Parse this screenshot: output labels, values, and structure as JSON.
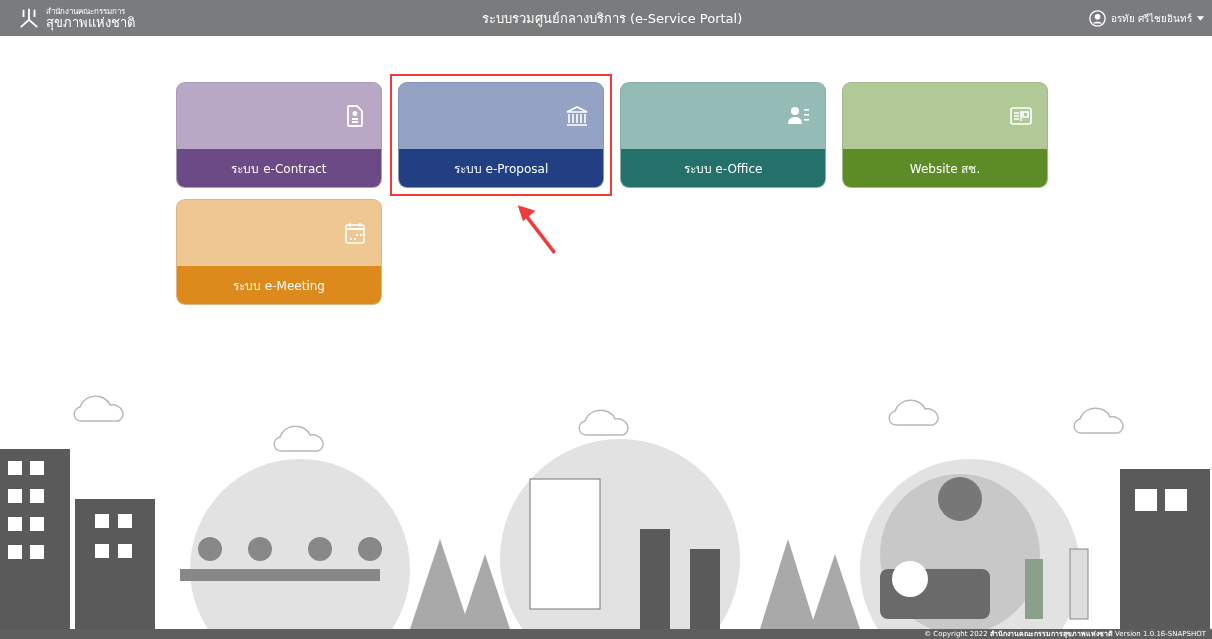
{
  "header": {
    "logo_line_1": "สำนักงานคณะกรรมการ",
    "logo_line_2": "สุขภาพแห่งชาติ",
    "title": "ระบบรวมศูนย์กลางบริการ (e-Service Portal)",
    "user": "อรทัย ศรีไชยอินทร์"
  },
  "cards": [
    {
      "label": "ระบบ e-Contract",
      "kind": "document",
      "color": "#6c4a86",
      "highlighted": false
    },
    {
      "label": "ระบบ e-Proposal",
      "kind": "bank",
      "color": "#213f82",
      "highlighted": true
    },
    {
      "label": "ระบบ e-Office",
      "kind": "contact",
      "color": "#23716a",
      "highlighted": false
    },
    {
      "label": "Website สช.",
      "kind": "id-card",
      "color": "#5d8c27",
      "highlighted": false
    },
    {
      "label": "ระบบ e-Meeting",
      "kind": "calendar",
      "color": "#dd8a1c",
      "highlighted": false
    }
  ],
  "footer": {
    "copyright": "© Copyright 2022 **สำนักงานคณะกรรมการสุขภาพแห่งชาติ** Version 1.0.16-SNAPSHOT"
  }
}
